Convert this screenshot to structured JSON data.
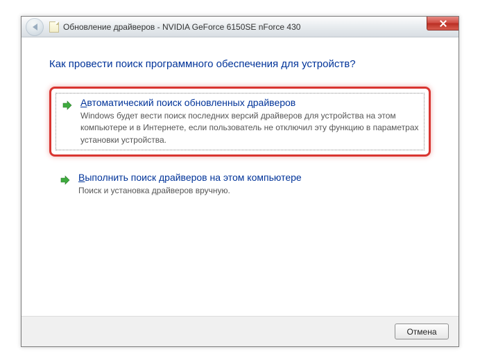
{
  "titlebar": {
    "title": "Обновление драйверов - NVIDIA GeForce 6150SE nForce 430"
  },
  "heading": "Как провести поиск программного обеспечения для устройств?",
  "options": [
    {
      "title_prefix": "А",
      "title_rest": "втоматический поиск обновленных драйверов",
      "desc": "Windows будет вести поиск последних версий драйверов для устройства на этом компьютере и в Интернете, если пользователь не отключил эту функцию в параметрах установки устройства."
    },
    {
      "title_prefix": "В",
      "title_rest": "ыполнить поиск драйверов на этом компьютере",
      "desc": "Поиск и установка драйверов вручную."
    }
  ],
  "footer": {
    "cancel": "Отмена"
  }
}
